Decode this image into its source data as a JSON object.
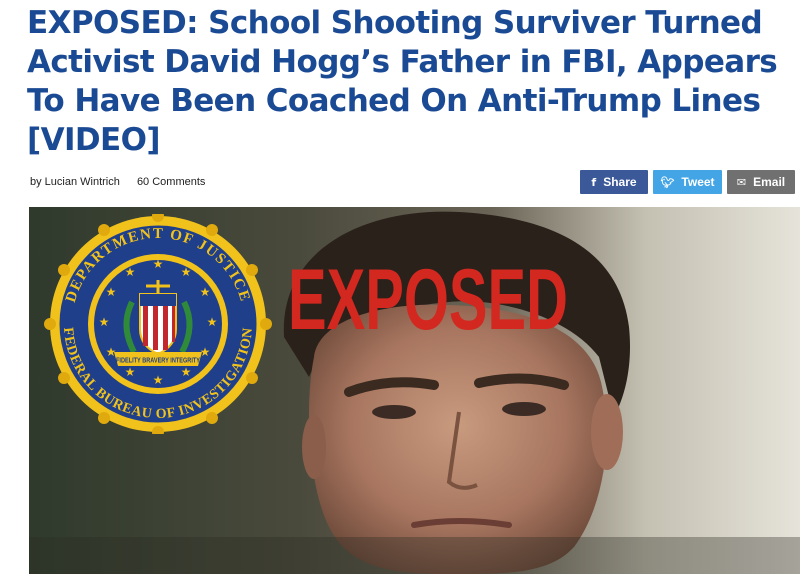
{
  "article": {
    "headline": "EXPOSED: School Shooting Surviver Turned Activist David Hogg’s Father in FBI, Appears To Have Been Coached On Anti-Trump Lines [VIDEO]",
    "author": "by Lucian Wintrich",
    "comments": "60 Comments"
  },
  "share": {
    "facebook_label": "Share",
    "twitter_label": "Tweet",
    "email_label": "Email",
    "colors": {
      "facebook": "#3b5998",
      "twitter": "#43a5e5",
      "email": "#707070"
    }
  },
  "image": {
    "overlay_text": "EXPOSED",
    "seal_top_text": "DEPARTMENT OF JUSTICE",
    "seal_bottom_text": "FEDERAL BUREAU OF INVESTIGATION",
    "seal_ribbon": {
      "left": "FIDELITY",
      "center": "BRAVERY",
      "right": "INTEGRITY"
    }
  },
  "colors": {
    "headline": "#1b4a94",
    "overlay_red": "#d3281f",
    "seal_gold": "#f1c21b",
    "seal_blue": "#1f3f8a"
  }
}
